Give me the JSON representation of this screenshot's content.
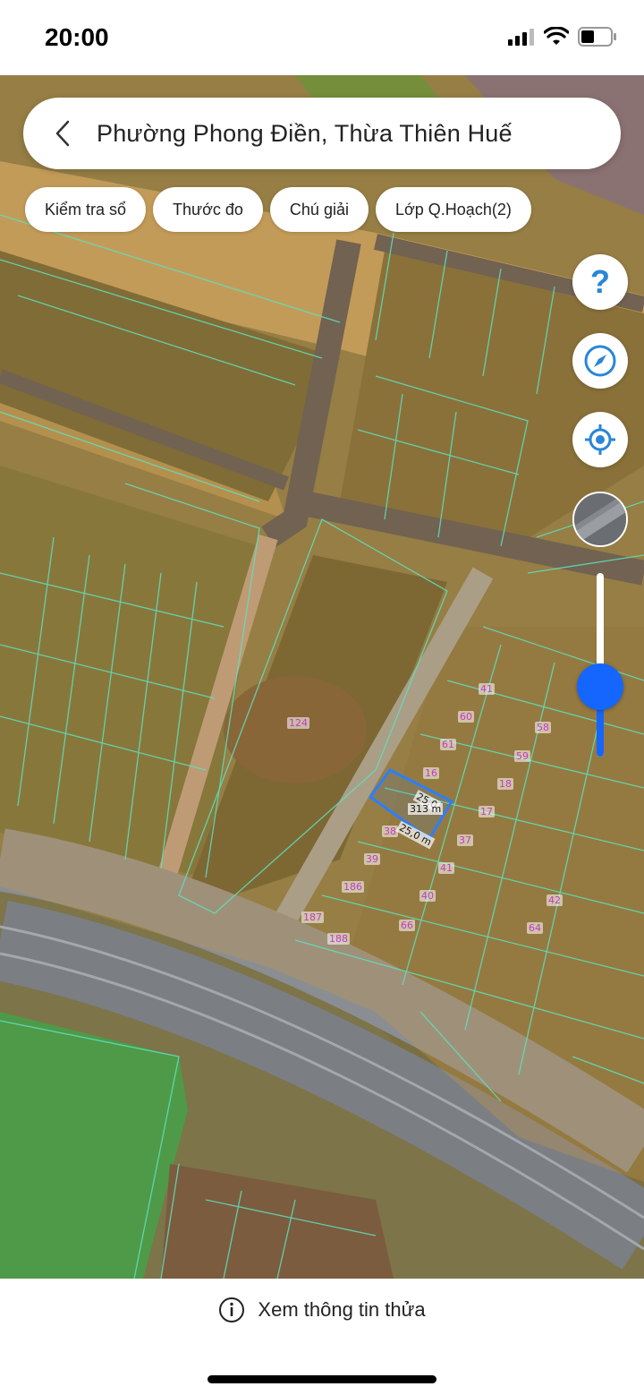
{
  "status_bar": {
    "time": "20:00"
  },
  "header": {
    "title": "Phường Phong Điền, Thừa Thiên Huế"
  },
  "chips": [
    {
      "label": "Kiểm tra sổ"
    },
    {
      "label": "Thước đo"
    },
    {
      "label": "Chú giải"
    },
    {
      "label": "Lớp Q.Hoạch(2)"
    }
  ],
  "controls": {
    "help_icon": "question-icon",
    "compass_icon": "compass-icon",
    "location_icon": "locate-icon",
    "zoom_level": 0.38
  },
  "map": {
    "parcel_labels": [
      "124",
      "41",
      "60",
      "58",
      "61",
      "59",
      "16",
      "18",
      "17",
      "38",
      "37",
      "39",
      "41",
      "186",
      "40",
      "187",
      "66",
      "188",
      "42",
      "64"
    ],
    "selected_parcel": {
      "area": "313 m",
      "side_top": "25,0",
      "side_bottom": "25,0 m"
    }
  },
  "bottom": {
    "info_label": "Xem thông tin thửa"
  },
  "colors": {
    "accent": "#1565ff",
    "parcel_line": "#5fe0c0",
    "parcel_label": "#c43bc4",
    "selected": "#2a7fff"
  }
}
